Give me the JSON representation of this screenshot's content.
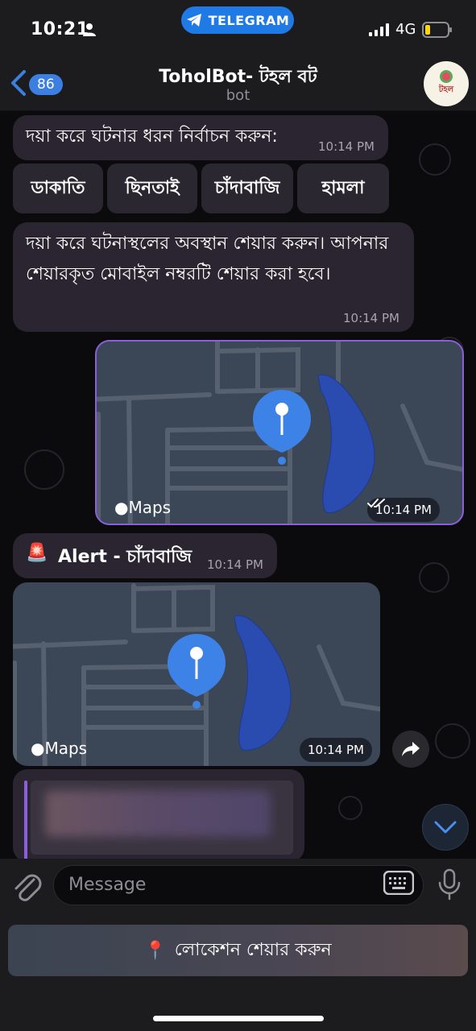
{
  "status_bar": {
    "time": "10:21",
    "source_pill": "TELEGRAM",
    "network": "4G"
  },
  "header": {
    "back_count": "86",
    "title": "ToholBot- টহল বট",
    "subtitle": "bot",
    "avatar_text": "টহল"
  },
  "messages": {
    "m1_text": "দয়া করে ঘটনার ধরন নির্বাচন করুন:",
    "m1_time": "10:14 PM",
    "options": [
      "ডাকাতি",
      "ছিনতাই",
      "চাঁদাবাজি",
      "হামলা"
    ],
    "m2_text": "দয়া করে ঘটনাস্থলের অবস্থান শেয়ার করুন। আপনার শেয়ারকৃত মোবাইল নম্বরটি শেয়ার করা হবে।",
    "m2_time": "10:14 PM",
    "map1_label": "Maps",
    "map1_time": "10:14 PM",
    "map1_status": "read",
    "alert_emoji": "🚨",
    "alert_text": "Alert - চাঁদাবাজি",
    "alert_time": "10:14 PM",
    "map2_label": "Maps",
    "map2_time": "10:14 PM"
  },
  "input": {
    "placeholder": "Message"
  },
  "reply_keyboard": {
    "pin_emoji": "📍",
    "share_location_label": "লোকেশন শেয়ার করুন"
  },
  "colors": {
    "accent": "#3d7fe0",
    "telegram_pill": "#1f7ae6",
    "outgoing_border": "#8b5fd8",
    "bubble_bg": "#2a2530",
    "map_bg": "#3b4656",
    "water": "#2a4cb0"
  },
  "icons": [
    "person-icon",
    "signal-icon",
    "battery-icon",
    "back-icon",
    "telegram-icon",
    "maps-apple-icon",
    "location-pin-icon",
    "double-check-icon",
    "forward-icon",
    "chevron-down-icon",
    "attach-icon",
    "keyboard-icon",
    "mic-icon"
  ]
}
